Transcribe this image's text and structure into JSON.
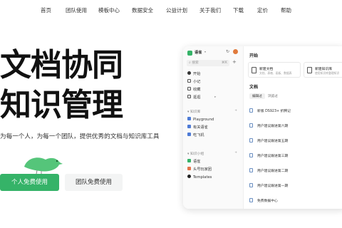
{
  "nav": {
    "items": [
      "首页",
      "团队使用",
      "模板中心",
      "数据安全",
      "公益计划",
      "关于我们",
      "下载",
      "定价",
      "帮助"
    ]
  },
  "hero": {
    "title_line1": "文档协同",
    "title_line2": "知识管理",
    "subtitle": "为每一个人，为每一个团队，提供优秀的文档与知识库工具",
    "primary_button": "个人免费使用",
    "secondary_button": "团队免费使用"
  },
  "app": {
    "sidebar": {
      "brand": "语雀",
      "search_placeholder": "搜索",
      "search_shortcut": "⌘K",
      "menu": [
        "开始",
        "小记",
        "收藏",
        "逛逛"
      ],
      "kb_section": "知识库",
      "kb_items": [
        "Playground",
        "有关语雀",
        "吃飞机"
      ],
      "group_section": "知识小组",
      "group_items": [
        "语雀",
        "头号玩家团",
        "Templates"
      ]
    },
    "main": {
      "start_title": "开始",
      "card_new_doc_title": "新建文档",
      "card_new_doc_desc": "文档、表格、画板、数据表",
      "card_new_kb_title": "新建知识库",
      "card_new_kb_desc": "使用知识库整理知识",
      "docs_title": "文档",
      "tabs": [
        "编辑过",
        "浏览过"
      ],
      "docs": [
        "新版 DS923+ 折腾记",
        "用户建议跟进第六期",
        "用户建议跟进第五期",
        "用户建议跟进第三期",
        "用户建议跟进第二期",
        "用户建议跟进第一期",
        "免费数据中心"
      ]
    }
  },
  "colors": {
    "brand_green": "#35b368",
    "bird_green": "#55c57a"
  }
}
